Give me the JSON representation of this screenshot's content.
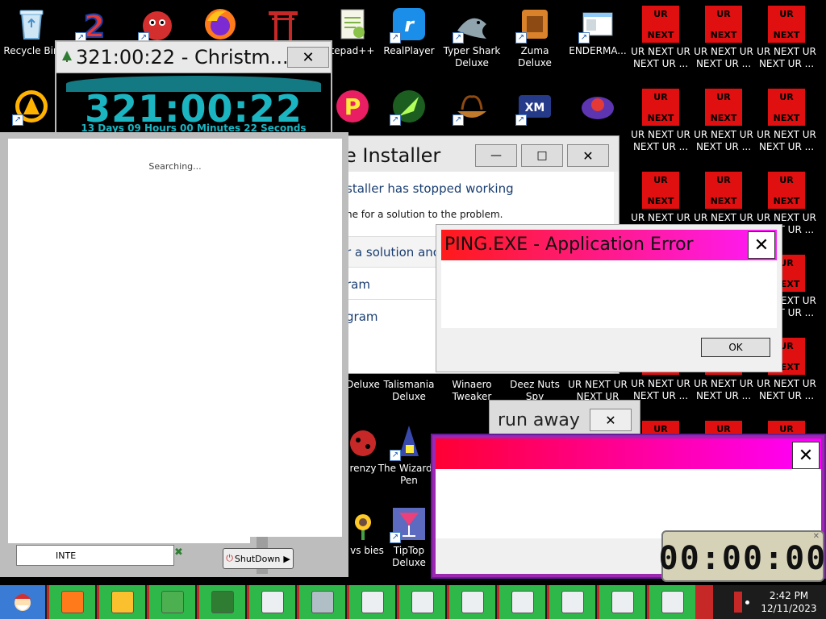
{
  "desktop_icons": [
    {
      "id": "recycle",
      "label": "Recycle Bin",
      "icon": "recycle-bin-icon"
    },
    {
      "id": "i2",
      "label": "",
      "icon": "number-two-icon"
    },
    {
      "id": "red",
      "label": "",
      "icon": "red-fuzzball-icon"
    },
    {
      "id": "firefox",
      "label": "",
      "icon": "firefox-icon"
    },
    {
      "id": "shrine",
      "label": "",
      "icon": "shrine-gate-icon"
    },
    {
      "id": "notepadpp",
      "label": "tepad++",
      "icon": "notepad-plus-icon"
    },
    {
      "id": "realplayer",
      "label": "RealPlayer",
      "icon": "realplayer-icon"
    },
    {
      "id": "typershark",
      "label": "Typer Shark Deluxe",
      "icon": "shark-icon"
    },
    {
      "id": "zuma",
      "label": "Zuma Deluxe",
      "icon": "zuma-icon"
    },
    {
      "id": "enderman",
      "label": "ENDERMA...",
      "icon": "window-icon"
    },
    {
      "id": "aimp",
      "label": "",
      "icon": "aimp-icon"
    },
    {
      "id": "plorp",
      "label": "",
      "icon": "pink-p-icon"
    },
    {
      "id": "rocket",
      "label": "",
      "icon": "rocket-icon"
    },
    {
      "id": "viking",
      "label": "",
      "icon": "viking-ship-icon"
    },
    {
      "id": "xmplay",
      "label": "",
      "icon": "xmplay-icon"
    },
    {
      "id": "freegame",
      "label": "",
      "icon": "game-orb-icon"
    },
    {
      "id": "talismania",
      "label": "Talismania Deluxe",
      "icon": ""
    },
    {
      "id": "winaero",
      "label": "Winaero Tweaker",
      "icon": ""
    },
    {
      "id": "deeznuts",
      "label": "Deez Nuts Spy",
      "icon": ""
    },
    {
      "id": "urnext-row",
      "label": "UR NEXT UR NEXT UR",
      "icon": ""
    },
    {
      "id": "partial1",
      "label": "Deluxe",
      "icon": ""
    },
    {
      "id": "frenzy",
      "label": "renzy",
      "icon": "ladybug-icon"
    },
    {
      "id": "wizards",
      "label": "The Wizard's Pen",
      "icon": "wizard-hat-icon"
    },
    {
      "id": "pvz",
      "label": "s vs bies",
      "icon": "flower-icon"
    },
    {
      "id": "tiptop",
      "label": "TipTop Deluxe",
      "icon": "cocktail-icon"
    }
  ],
  "urnext": {
    "top": "UR",
    "bottom": "NEXT",
    "caption1": "UR NEXT UR",
    "caption2": "NEXT UR ..."
  },
  "countdown_window": {
    "title": "321:00:22 - Christm...",
    "big_time": "321:00:22",
    "sub": "13 Days 09 Hours 00 Minutes 22 Seconds",
    "close": "✕"
  },
  "search_panel": {
    "status": "Searching...",
    "input_value": "INTE",
    "shutdown_label": "ShutDown"
  },
  "installer_window": {
    "title": "e Installer",
    "line1": "staller has stopped working",
    "line2": "ne for a solution to the problem.",
    "option1": "r a solution and",
    "option2": "ram",
    "option3": "gram",
    "min": "—",
    "max": "□",
    "close": "✕"
  },
  "ping_error": {
    "title": "PING.EXE - Application Error",
    "ok_label": "OK",
    "close": "✕"
  },
  "run_away": {
    "title": "run away",
    "close": "✕"
  },
  "pink_window": {
    "close": "✕"
  },
  "timer": {
    "display": "00:00:00"
  },
  "taskbar": {
    "time": "2:42 PM",
    "date": "12/11/2023"
  },
  "colors": {
    "taskbar_green": "#2fb84a",
    "ur_red": "#e01010",
    "ping_grad_from": "#ff1a1a",
    "ping_grad_to": "#ff1aff",
    "countdown_teal": "#1bb5c2"
  }
}
